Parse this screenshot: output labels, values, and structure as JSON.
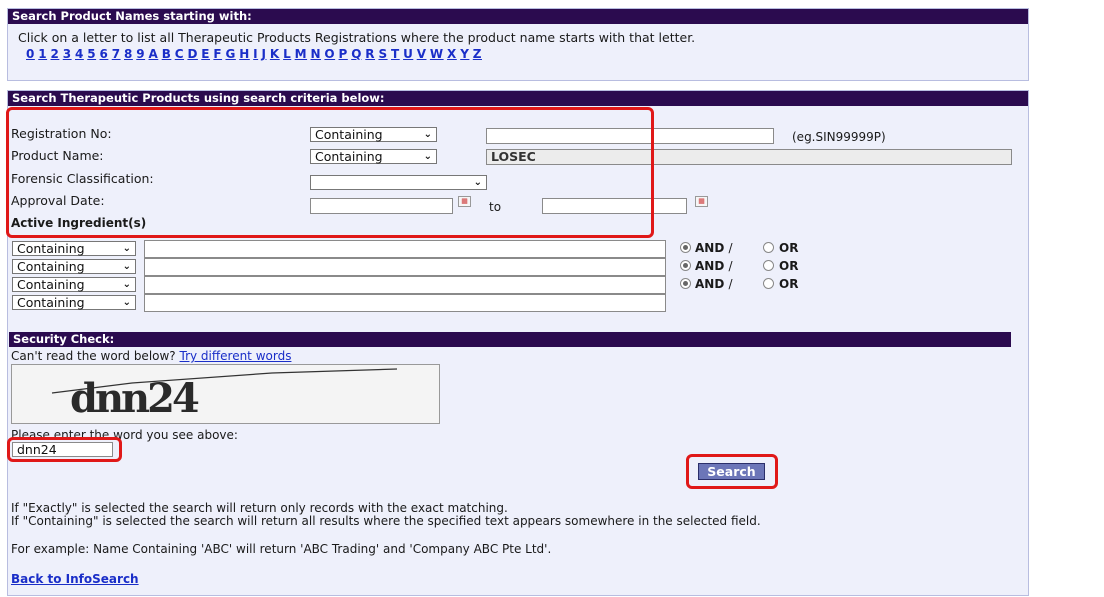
{
  "browse": {
    "header": "Search Product Names starting with:",
    "instruction": "Click on a letter to list all Therapeutic Products Registrations where the product name starts with that letter.",
    "letters": [
      "0",
      "1",
      "2",
      "3",
      "4",
      "5",
      "6",
      "7",
      "8",
      "9",
      "A",
      "B",
      "C",
      "D",
      "E",
      "F",
      "G",
      "H",
      "I",
      "J",
      "K",
      "L",
      "M",
      "N",
      "O",
      "P",
      "Q",
      "R",
      "S",
      "T",
      "U",
      "V",
      "W",
      "X",
      "Y",
      "Z"
    ]
  },
  "criteria": {
    "header": "Search Therapeutic Products using search criteria below:",
    "registration": {
      "label": "Registration No:",
      "mode": "Containing",
      "value": "",
      "hint": "(eg.SIN99999P)"
    },
    "product": {
      "label": "Product Name:",
      "mode": "Containing",
      "value": "LOSEC"
    },
    "forensic": {
      "label": "Forensic Classification:",
      "value": ""
    },
    "approval": {
      "label": "Approval Date:",
      "from": "",
      "to_label": "to",
      "to": ""
    },
    "ingredients": {
      "label": "Active Ingredient(s)",
      "rows": [
        {
          "mode": "Containing",
          "value": "",
          "and": "AND",
          "sep": "/",
          "or": "OR",
          "selected": "AND"
        },
        {
          "mode": "Containing",
          "value": "",
          "and": "AND",
          "sep": "/",
          "or": "OR",
          "selected": "AND"
        },
        {
          "mode": "Containing",
          "value": "",
          "and": "AND",
          "sep": "/",
          "or": "OR",
          "selected": "AND"
        },
        {
          "mode": "Containing",
          "value": ""
        }
      ]
    }
  },
  "security": {
    "header": "Security Check:",
    "cant_read": "Can't read the word below?",
    "try_link": "Try different words",
    "captcha_text": "dnn24",
    "prompt": "Please enter the word you see above:",
    "input_value": "dnn24"
  },
  "search_button": "Search",
  "notes": [
    "If \"Exactly\" is selected the search will return only records with the exact matching.",
    "If \"Containing\" is selected the search will return all results where the specified text appears somewhere in the selected field.",
    "For example: Name Containing 'ABC' will return 'ABC Trading' and 'Company ABC Pte Ltd'."
  ],
  "back_link": "Back to InfoSearch",
  "colors": {
    "header_bar": "#2b0b4f",
    "panel_bg": "#eef0fb",
    "link": "#1a2ec8",
    "highlight": "#e01818"
  }
}
